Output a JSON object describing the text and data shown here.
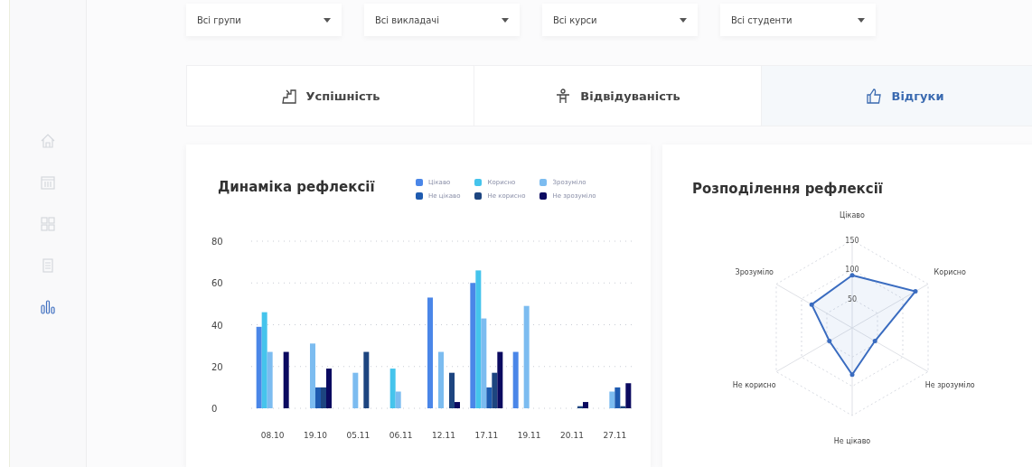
{
  "sidebar": {
    "items": [
      {
        "kind": "home",
        "selected": false
      },
      {
        "kind": "calendar",
        "selected": false
      },
      {
        "kind": "grid",
        "selected": false
      },
      {
        "kind": "document",
        "selected": false
      },
      {
        "kind": "chart",
        "selected": true
      }
    ]
  },
  "filters": [
    {
      "value": "Всі групи"
    },
    {
      "value": "Всі викладачі"
    },
    {
      "value": "Всі курси"
    },
    {
      "value": "Всі студенти"
    }
  ],
  "tabs": [
    {
      "label": "Успішність",
      "kind": "stairs",
      "selected": false
    },
    {
      "label": "Відвідуваність",
      "kind": "person",
      "selected": false
    },
    {
      "label": "Відгуки",
      "kind": "thumb",
      "selected": true
    }
  ],
  "dynamics": {
    "title": "Динаміка рефлексії",
    "chart_data": {
      "type": "bar",
      "categories": [
        "08.10",
        "19.10",
        "05.11",
        "06.11",
        "12.11",
        "17.11",
        "19.11",
        "20.11",
        "27.11"
      ],
      "ylim": [
        0,
        80
      ],
      "yticks": [
        0,
        20,
        40,
        60,
        80
      ],
      "grid": true,
      "series": [
        {
          "name": "Цікаво",
          "color": "#4a86e8",
          "values": [
            39,
            0,
            0,
            0,
            53,
            60,
            27,
            0,
            0
          ]
        },
        {
          "name": "Корисно",
          "color": "#45c4ec",
          "values": [
            46,
            0,
            0,
            19,
            0,
            66,
            0,
            0,
            0
          ]
        },
        {
          "name": "Зрозуміло",
          "color": "#7cbcf0",
          "values": [
            27,
            31,
            17,
            8,
            27,
            43,
            49,
            0,
            8
          ]
        },
        {
          "name": "Не цікаво",
          "color": "#1e5bb0",
          "values": [
            0,
            10,
            0,
            0,
            0,
            10,
            0,
            0,
            10
          ]
        },
        {
          "name": "Не корисно",
          "color": "#1d4580",
          "values": [
            0,
            10,
            27,
            0,
            17,
            17,
            0,
            1,
            1
          ]
        },
        {
          "name": "Не зрозуміло",
          "color": "#0b0a60",
          "values": [
            27,
            19,
            0,
            0,
            3,
            27,
            0,
            3,
            12
          ]
        }
      ]
    }
  },
  "distribution": {
    "title": "Розподілення рефлексії",
    "chart_data": {
      "type": "radar",
      "categories": [
        "Цікаво",
        "Корисно",
        "Не зрозуміло",
        "Не цікаво",
        "Не корисно",
        "Зрозуміло"
      ],
      "ylim": [
        0,
        150
      ],
      "yticks": [
        50,
        100,
        150
      ],
      "series": [
        {
          "color": "#3a6cc0",
          "values": [
            90,
            125,
            45,
            80,
            45,
            80
          ]
        }
      ]
    }
  }
}
